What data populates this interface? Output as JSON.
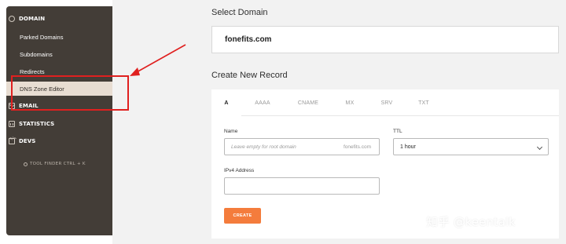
{
  "sidebar": {
    "sections": [
      {
        "label": "DOMAIN",
        "icon": "globe-icon"
      },
      {
        "label": "EMAIL",
        "icon": "mail-icon"
      },
      {
        "label": "STATISTICS",
        "icon": "bar-chart-icon"
      },
      {
        "label": "DEVS",
        "icon": "code-icon"
      }
    ],
    "items": [
      {
        "label": "Parked Domains"
      },
      {
        "label": "Subdomains"
      },
      {
        "label": "Redirects"
      },
      {
        "label": "DNS Zone Editor",
        "active": true
      }
    ],
    "tool_finder": "TOOL FINDER CTRL + K"
  },
  "main": {
    "select_title": "Select Domain",
    "domain": "fonefits.com",
    "create_title": "Create New Record",
    "tabs": [
      {
        "label": "A",
        "active": true
      },
      {
        "label": "AAAA"
      },
      {
        "label": "CNAME"
      },
      {
        "label": "MX"
      },
      {
        "label": "SRV"
      },
      {
        "label": "TXT"
      }
    ],
    "form": {
      "name_label": "Name",
      "name_placeholder": "Leave empty for root domain",
      "name_suffix": "fonefits.com",
      "ttl_label": "TTL",
      "ttl_value": "1 hour",
      "ipv4_label": "IPv4 Address",
      "ipv4_value": "",
      "create_label": "CREATE"
    }
  },
  "watermark": "知乎 @keentalk",
  "colors": {
    "sidebar_bg": "#433d37",
    "active_item_bg": "#e8ddd2",
    "accent": "#f47c3c",
    "annotation": "#e0201f",
    "main_bg": "#f2f2f2"
  }
}
